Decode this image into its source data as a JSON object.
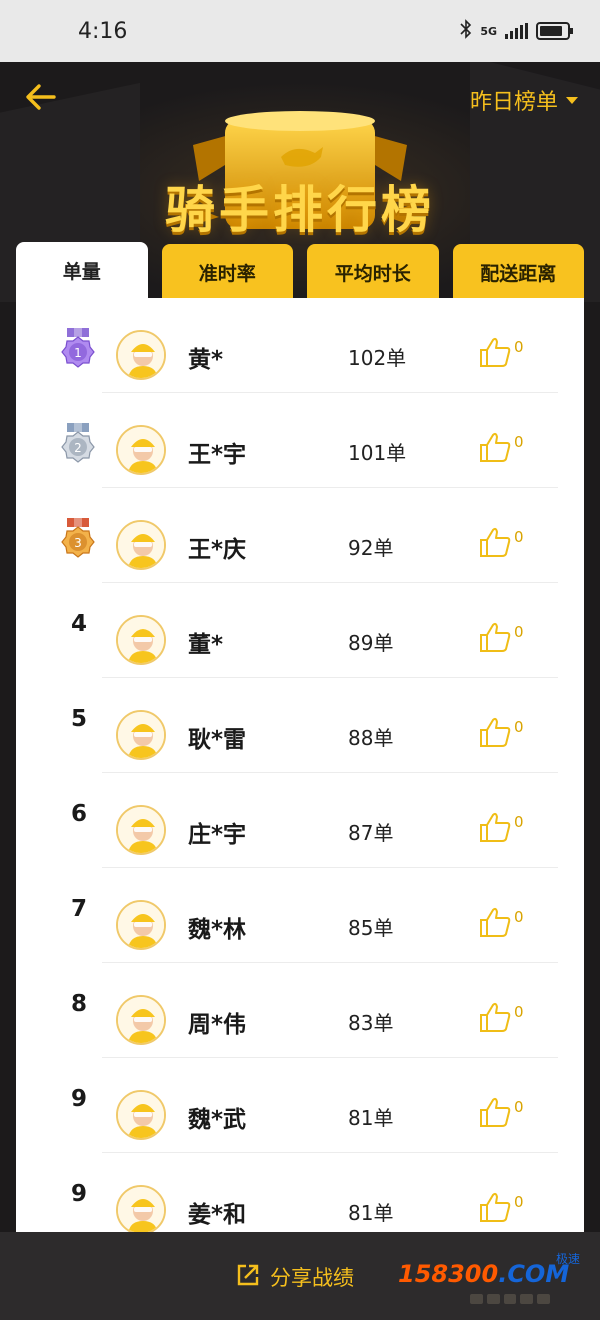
{
  "status_bar": {
    "time": "4:16",
    "network": "5G",
    "battery_level": 0.85
  },
  "header": {
    "range_label": "昨日榜单",
    "title": "骑手排行榜"
  },
  "tabs": [
    {
      "label": "单量",
      "active": true
    },
    {
      "label": "准时率",
      "active": false
    },
    {
      "label": "平均时长",
      "active": false
    },
    {
      "label": "配送距离",
      "active": false
    }
  ],
  "riders": [
    {
      "rank": "1",
      "medal": "purple",
      "name": "黄*",
      "count": "102单",
      "likes": "0"
    },
    {
      "rank": "2",
      "medal": "silver",
      "name": "王*宇",
      "count": "101单",
      "likes": "0"
    },
    {
      "rank": "3",
      "medal": "bronze",
      "name": "王*庆",
      "count": "92单",
      "likes": "0"
    },
    {
      "rank": "4",
      "medal": "",
      "name": "董*",
      "count": "89单",
      "likes": "0"
    },
    {
      "rank": "5",
      "medal": "",
      "name": "耿*雷",
      "count": "88单",
      "likes": "0"
    },
    {
      "rank": "6",
      "medal": "",
      "name": "庄*宇",
      "count": "87单",
      "likes": "0"
    },
    {
      "rank": "7",
      "medal": "",
      "name": "魏*林",
      "count": "85单",
      "likes": "0"
    },
    {
      "rank": "8",
      "medal": "",
      "name": "周*伟",
      "count": "83单",
      "likes": "0"
    },
    {
      "rank": "9",
      "medal": "",
      "name": "魏*武",
      "count": "81单",
      "likes": "0"
    },
    {
      "rank": "9",
      "medal": "",
      "name": "姜*和",
      "count": "81单",
      "likes": "0"
    }
  ],
  "footer": {
    "share_label": "分享战绩",
    "watermark_main": "158300",
    "watermark_domain": ".COM",
    "watermark_tag": "极速"
  },
  "colors": {
    "accent": "#f5bf1d",
    "tab_yellow": "#f8c21f",
    "medal_purple": "#9b6fe0",
    "medal_silver": "#aeb8c6",
    "medal_bronze": "#e39a2c"
  }
}
